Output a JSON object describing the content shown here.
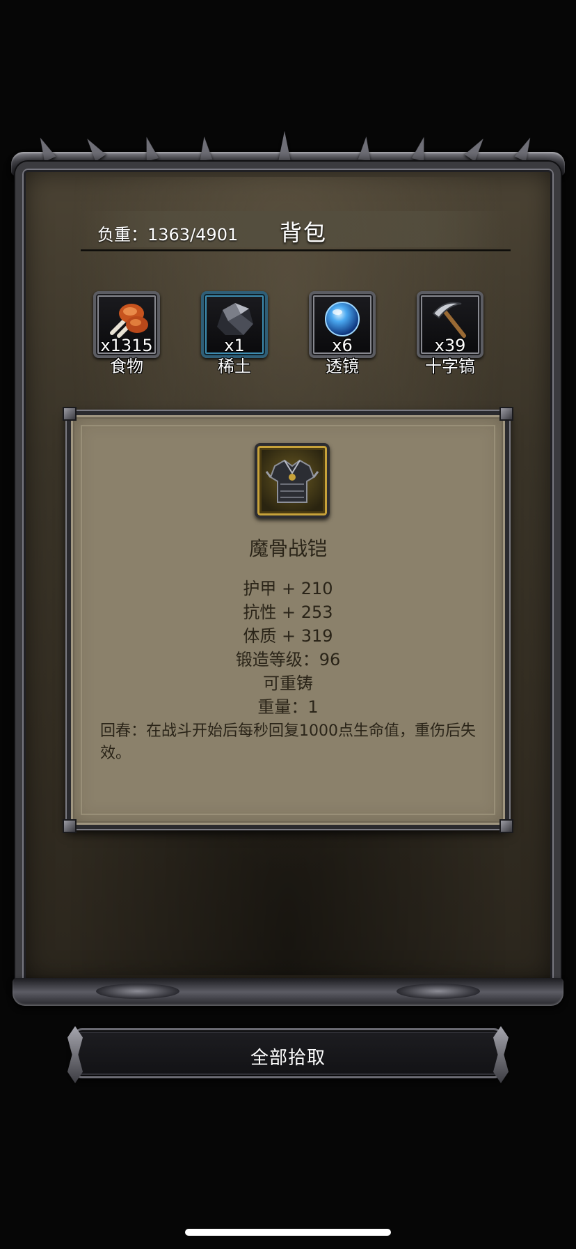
{
  "bag": {
    "title": "背包",
    "weight": "负重：1363/4901",
    "items": [
      {
        "name": "食物",
        "count": "x1315",
        "icon": "meat-icon",
        "rarity": "common"
      },
      {
        "name": "稀土",
        "count": "x1",
        "icon": "ore-icon",
        "rarity": "rare"
      },
      {
        "name": "透镜",
        "count": "x6",
        "icon": "lens-orb-icon",
        "rarity": "common"
      },
      {
        "name": "十字镐",
        "count": "x39",
        "icon": "pickaxe-icon",
        "rarity": "common"
      }
    ]
  },
  "tooltip": {
    "item_name": "魔骨战铠",
    "icon": "armor-icon",
    "stats": [
      "护甲 + 210",
      "抗性 + 253",
      "体质 + 319",
      "锻造等级：96",
      "可重铸",
      "重量：1"
    ],
    "description": "回春：在战斗开始后每秒回复1000点生命值，重伤后失效。"
  },
  "actions": {
    "collect_all": "全部拾取"
  },
  "colors": {
    "parchment": "#8b816b",
    "rare_border": "#3d8cb0",
    "epic_border": "#c7a23a"
  }
}
